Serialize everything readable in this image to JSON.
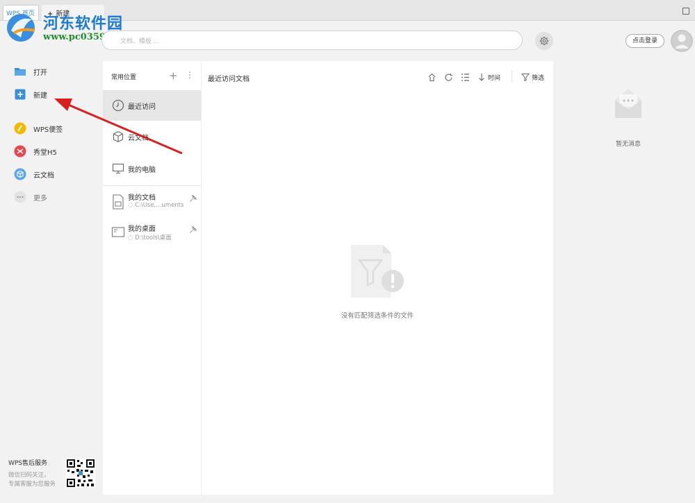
{
  "titlebar": {
    "app_tab": "WPS 首页",
    "new_tab": "新建"
  },
  "watermark": {
    "site_name": "河东软件园",
    "url": "www.pc0359.cn"
  },
  "search": {
    "placeholder": "文档、模板 ..."
  },
  "header": {
    "login_label": "点击登录"
  },
  "sidebar": {
    "items": [
      {
        "label": "打开",
        "icon": "folder-icon"
      },
      {
        "label": "新建",
        "icon": "plus-square-icon"
      },
      {
        "label": "WPS便签",
        "icon": "pencil-circle-icon"
      },
      {
        "label": "秀堂H5",
        "icon": "xiutang-icon"
      },
      {
        "label": "云文档",
        "icon": "cloud-doc-icon"
      },
      {
        "label": "更多",
        "icon": "more-icon"
      }
    ],
    "service": {
      "title": "WPS售后服务",
      "line1": "微信扫码关注，",
      "line2": "专属客服为您服务"
    }
  },
  "locations": {
    "header": "常用位置",
    "items": [
      {
        "label": "最近访问",
        "icon": "clock-icon",
        "active": true
      },
      {
        "label": "云文档",
        "icon": "cube-icon"
      },
      {
        "label": "我的电脑",
        "icon": "monitor-icon"
      }
    ],
    "pinned": [
      {
        "label": "我的文档",
        "path": "C:\\Use....uments"
      },
      {
        "label": "我的桌面",
        "path": "D:\\tools\\桌面"
      }
    ]
  },
  "documents": {
    "title": "最近访问文档",
    "sort_label": "时间",
    "filter_label": "筛选",
    "empty_text": "没有匹配筛选条件的文件"
  },
  "messages": {
    "empty_text": "暂无消息"
  },
  "colors": {
    "accent_blue": "#3b8fd6",
    "annotation_red": "#d9201f",
    "watermark_blue": "#1d7ad4",
    "watermark_green": "#1e8f2c"
  }
}
